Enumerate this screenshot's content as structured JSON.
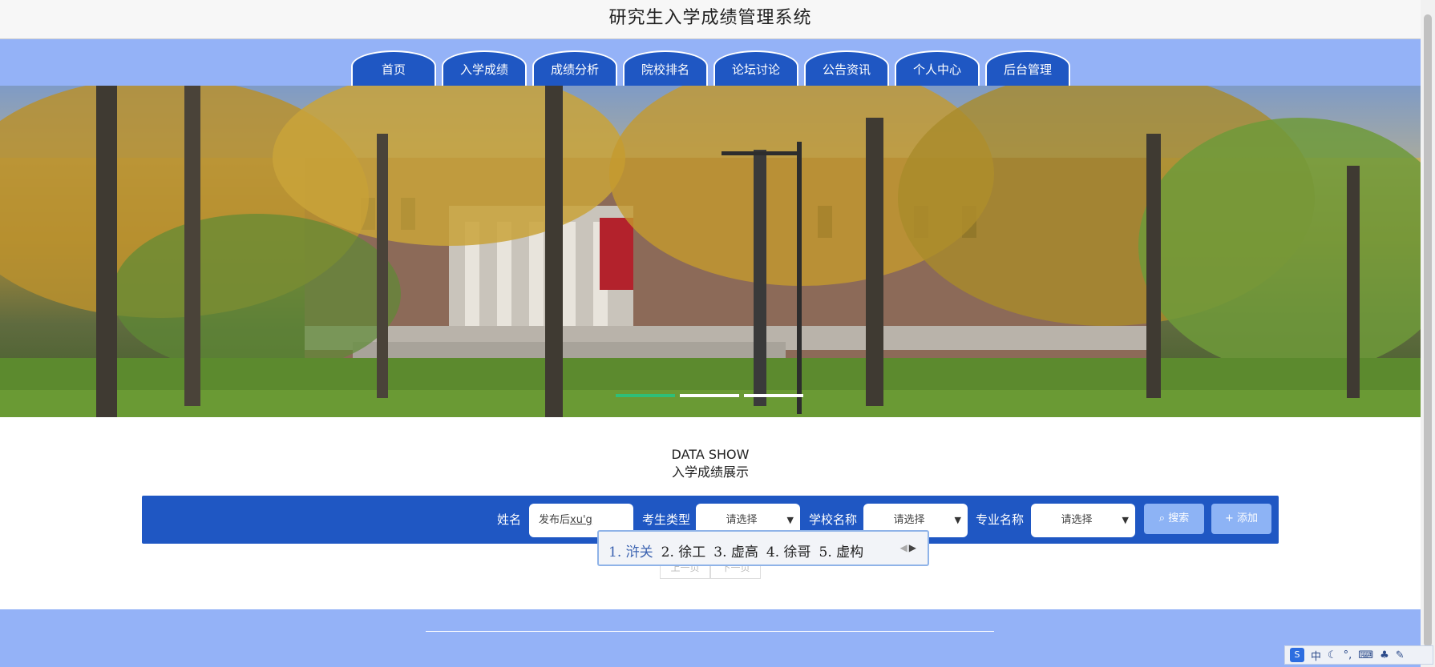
{
  "header": {
    "title": "研究生入学成绩管理系统"
  },
  "nav": {
    "tabs": [
      {
        "label": "首页"
      },
      {
        "label": "入学成绩"
      },
      {
        "label": "成绩分析"
      },
      {
        "label": "院校排名"
      },
      {
        "label": "论坛讨论"
      },
      {
        "label": "公告资讯"
      },
      {
        "label": "个人中心"
      },
      {
        "label": "后台管理"
      }
    ]
  },
  "carousel": {
    "active_index": 0,
    "count": 3
  },
  "section": {
    "en": "DATA SHOW",
    "cn": "入学成绩展示"
  },
  "search": {
    "name_label": "姓名",
    "name_value": "发布后",
    "name_ime": "xu'g",
    "exam_type_label": "考生类型",
    "exam_type_value": "请选择",
    "school_label": "学校名称",
    "school_value": "请选择",
    "major_label": "专业名称",
    "major_value": "请选择",
    "search_button": "搜索",
    "add_button": "添加"
  },
  "pager": {
    "prev": "上一页",
    "next": "下一页"
  },
  "ime": {
    "candidates": [
      "1. 浒关",
      "2. 徐工",
      "3. 虚高",
      "4. 徐哥",
      "5. 虚构"
    ],
    "toolbar_mode": "中"
  },
  "colors": {
    "primary": "#1f57c3",
    "light_bar": "#94b2f7",
    "button": "#8db3f5",
    "active_dot": "#2fbf78"
  }
}
